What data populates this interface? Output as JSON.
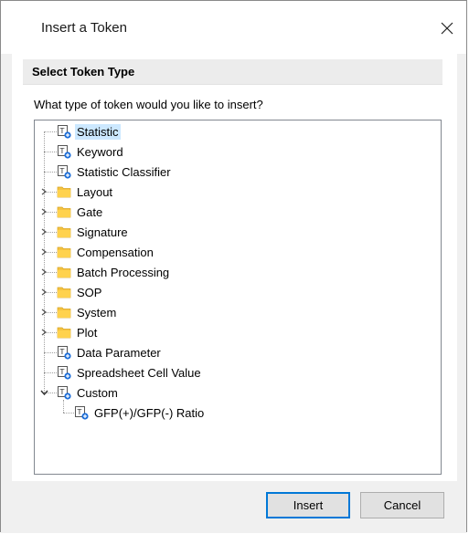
{
  "window": {
    "title": "Insert a Token"
  },
  "section": {
    "header": "Select Token Type",
    "question": "What type of token would you like to insert?"
  },
  "tree": {
    "items": [
      {
        "label": "Statistic",
        "type": "token",
        "selected": true
      },
      {
        "label": "Keyword",
        "type": "token"
      },
      {
        "label": "Statistic Classifier",
        "type": "token"
      },
      {
        "label": "Layout",
        "type": "folder",
        "state": "collapsed"
      },
      {
        "label": "Gate",
        "type": "folder",
        "state": "collapsed"
      },
      {
        "label": "Signature",
        "type": "folder",
        "state": "collapsed"
      },
      {
        "label": "Compensation",
        "type": "folder",
        "state": "collapsed"
      },
      {
        "label": "Batch Processing",
        "type": "folder",
        "state": "collapsed"
      },
      {
        "label": "SOP",
        "type": "folder",
        "state": "collapsed"
      },
      {
        "label": "System",
        "type": "folder",
        "state": "collapsed"
      },
      {
        "label": "Plot",
        "type": "folder",
        "state": "collapsed"
      },
      {
        "label": "Data Parameter",
        "type": "token"
      },
      {
        "label": "Spreadsheet Cell Value",
        "type": "token"
      },
      {
        "label": "Custom",
        "type": "token",
        "state": "expanded"
      },
      {
        "label": "GFP(+)/GFP(-) Ratio",
        "type": "token",
        "child": true
      }
    ]
  },
  "buttons": {
    "insert": "Insert",
    "cancel": "Cancel"
  },
  "colors": {
    "selection": "#cce8ff",
    "folder": "#f5c342",
    "default_border": "#0078d7",
    "token_badge": "#1e6fd9"
  }
}
